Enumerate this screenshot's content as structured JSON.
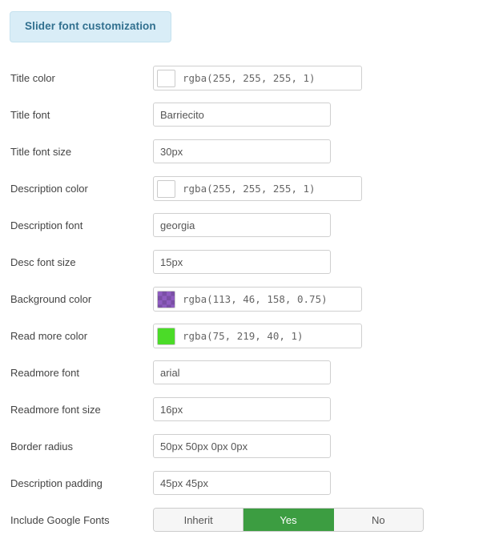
{
  "tab": {
    "label": "Slider font customization",
    "bg_color": "#d9edf7",
    "text_color": "#31708f"
  },
  "form": {
    "rows": [
      {
        "label": "Title color",
        "type": "color",
        "value": "rgba(255, 255, 255, 1)",
        "swatch_color": "#ffffff",
        "swatch_transparent": false
      },
      {
        "label": "Title font",
        "type": "text",
        "value": "Barriecito"
      },
      {
        "label": "Title font size",
        "type": "text",
        "value": "30px"
      },
      {
        "label": "Description color",
        "type": "color",
        "value": "rgba(255, 255, 255, 1)",
        "swatch_color": "#ffffff",
        "swatch_transparent": false
      },
      {
        "label": "Description font",
        "type": "text",
        "value": "georgia"
      },
      {
        "label": "Desc font size",
        "type": "text",
        "value": "15px"
      },
      {
        "label": "Background color",
        "type": "color",
        "value": "rgba(113, 46, 158, 0.75)",
        "swatch_color": "#8e5cc0",
        "swatch_transparent": true
      },
      {
        "label": "Read more color",
        "type": "color",
        "value": "rgba(75, 219, 40, 1)",
        "swatch_color": "#4bdb28",
        "swatch_transparent": false
      },
      {
        "label": "Readmore font",
        "type": "text",
        "value": "arial"
      },
      {
        "label": "Readmore font size",
        "type": "text",
        "value": "16px"
      },
      {
        "label": "Border radius",
        "type": "text",
        "value": "50px 50px 0px 0px"
      },
      {
        "label": "Description padding",
        "type": "text",
        "value": "45px 45px"
      },
      {
        "label": "Include Google Fonts",
        "type": "buttongroup",
        "options": [
          "Inherit",
          "Yes",
          "No"
        ],
        "selected": "Yes",
        "active_color": "#3c9d41"
      }
    ]
  }
}
